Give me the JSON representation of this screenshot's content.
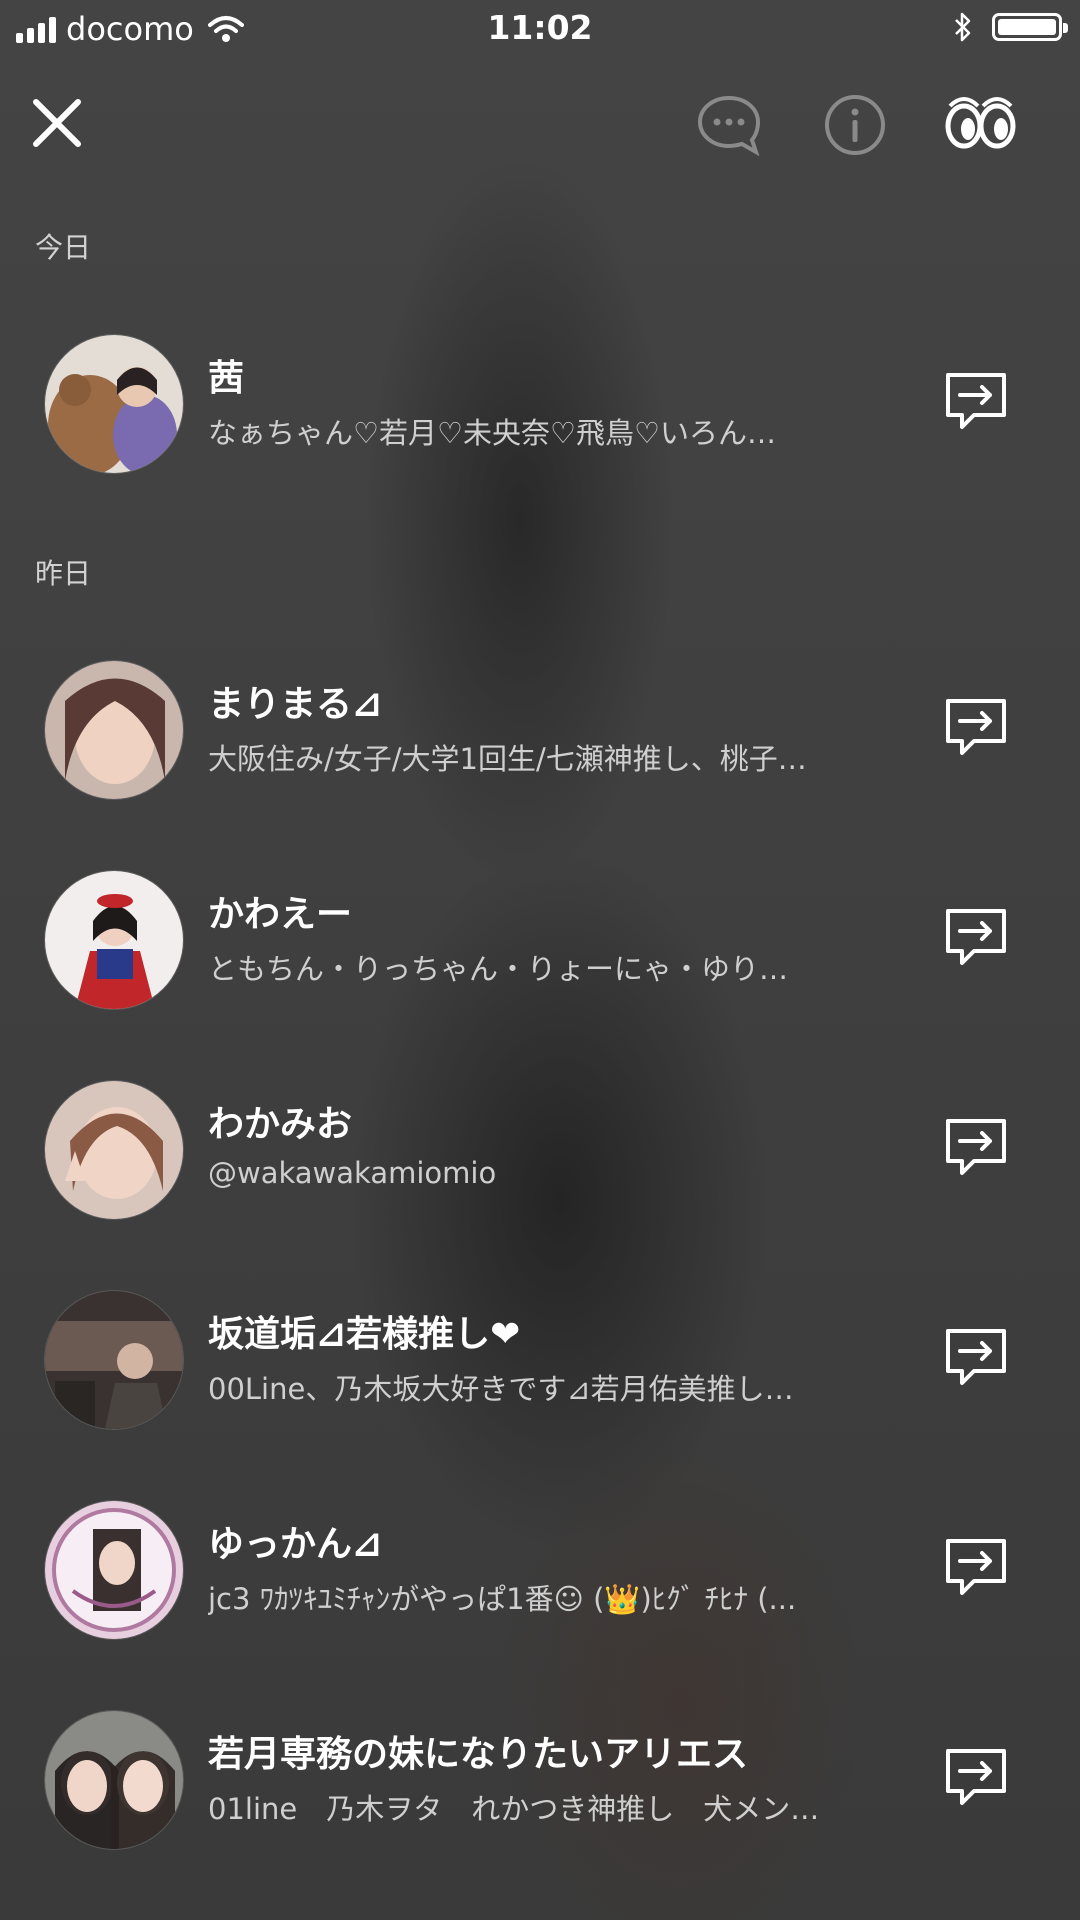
{
  "status_bar": {
    "carrier": "docomo",
    "time": "11:02"
  },
  "header": {
    "close_icon": "close-icon",
    "chat_icon": "chat-bubble-icon",
    "info_icon": "info-icon",
    "eyes_icon": "eyes-icon"
  },
  "sections": [
    {
      "label": "今日",
      "items": [
        {
          "name": "茜",
          "desc": "なぁちゃん♡若月♡未央奈♡飛鳥♡いろんな人と繋がりたいです",
          "desc_display": "なぁちゃん♡若月♡未央奈♡飛鳥♡いろん…"
        }
      ]
    },
    {
      "label": "昨日",
      "items": [
        {
          "name": "まりまる⊿",
          "desc_display": "大阪住み/女子/大学1回生/七瀬神推し、桃子…"
        },
        {
          "name": "かわえー",
          "desc_display": "ともちん・りっちゃん・りょーにゃ・ゆり…"
        },
        {
          "name": "わかみお",
          "desc_display": "@wakawakamiomio"
        },
        {
          "name": "坂道垢⊿若様推し❤",
          "desc_display": "00Line、乃木坂大好きです⊿若月佑美推し…"
        },
        {
          "name": "ゆっかん⊿",
          "desc_display": "jc3 ﾜｶﾂｷﾕﾐﾁｬﾝがやっぱ1番☺ (👑)ﾋｸﾞ ﾁﾋﾅ (..."
        },
        {
          "name": "若月専務の妹になりたいアリエス",
          "desc_display": "01line　乃木ヲタ　れかつき神推し　犬メン…"
        }
      ]
    }
  ],
  "colors": {
    "background": "#3f3f3f",
    "section_label": "#d2d2d2",
    "description": "#cfcfcf"
  }
}
